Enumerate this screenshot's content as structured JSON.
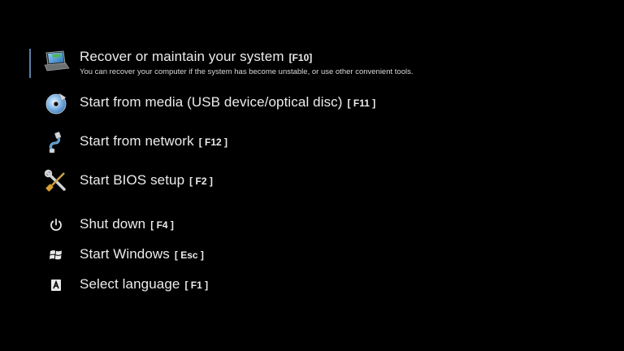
{
  "menu": {
    "items": [
      {
        "label": "Recover or maintain your system",
        "key": "[F10]",
        "description": "You can recover your computer if the system has become unstable, or use other convenient tools.",
        "icon": "laptop-recovery-icon",
        "selected": true
      },
      {
        "label": "Start from media (USB device/optical disc)",
        "key": "[ F11 ]",
        "icon": "disc-icon"
      },
      {
        "label": "Start from network",
        "key": "[ F12 ]",
        "icon": "network-cable-icon"
      },
      {
        "label": "Start BIOS setup",
        "key": "[ F2 ]",
        "icon": "tools-icon"
      },
      {
        "label": "Shut down",
        "key": "[ F4 ]",
        "icon": "power-icon"
      },
      {
        "label": "Start Windows",
        "key": "[ Esc ]",
        "icon": "windows-logo-icon"
      },
      {
        "label": "Select language",
        "key": "[ F1 ]",
        "icon": "language-icon"
      }
    ]
  },
  "colors": {
    "background": "#000000",
    "text": "#ececec",
    "selection_accent": "#5a7fa8"
  }
}
